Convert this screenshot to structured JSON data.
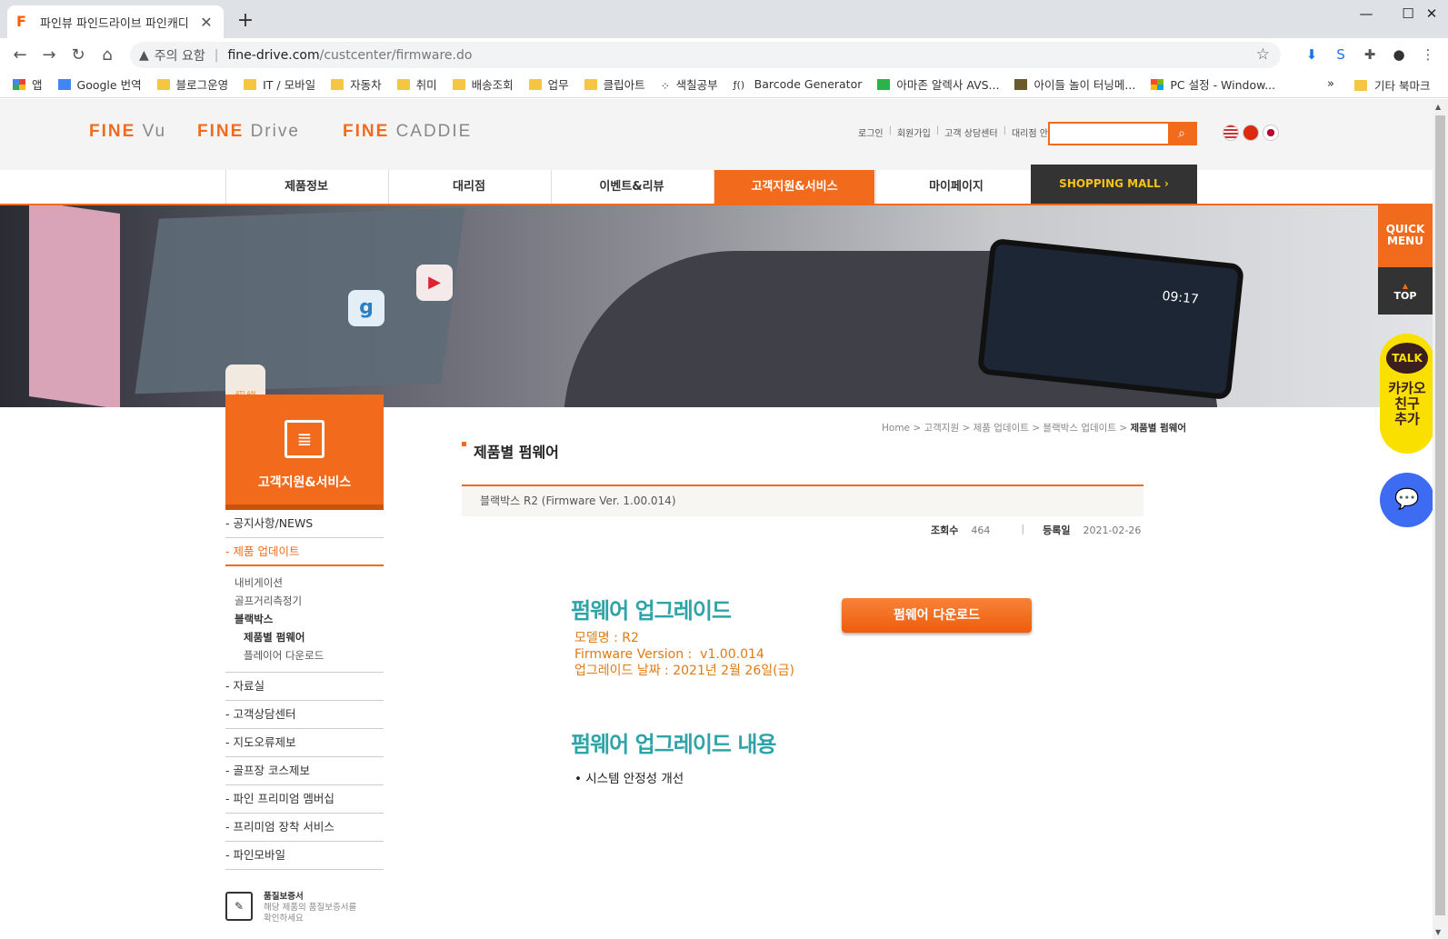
{
  "browser": {
    "tab_title": "파인뷰 파인드라이브 파인캐디",
    "address": {
      "warning": "주의 요함",
      "host": "fine-drive.com",
      "path": "/custcenter/firmware.do"
    },
    "bookmarks": [
      "앱",
      "Google 번역",
      "블로그운영",
      "IT / 모바일",
      "자동차",
      "취미",
      "배송조회",
      "업무",
      "클립아트",
      "색칠공부",
      "Barcode Generator",
      "아마존 알렉사 AVS...",
      "아이들 놀이 터닝메...",
      "PC 설정 - Window..."
    ],
    "bookmarks_more": "»",
    "other_bookmarks": "기타 북마크"
  },
  "site": {
    "logos": {
      "finevu_a": "FINE",
      "finevu_b": "Vu",
      "finedrive_a": "FINE",
      "finedrive_b": "Drive",
      "finecaddie_a": "FINE",
      "finecaddie_b": "CADDIE"
    },
    "util": [
      "로그인",
      "회원가입",
      "고객 상담센터",
      "대리점 안내"
    ],
    "gnb": [
      "제품정보",
      "대리점",
      "이벤트&리뷰",
      "고객지원&서비스",
      "마이페이지"
    ],
    "mall": "SHOPPING MALL  ›",
    "quick": {
      "line1": "QUICK",
      "line2": "MENU"
    },
    "top": "TOP",
    "talk": {
      "badge": "TALK",
      "line1": "카카오",
      "line2": "친구",
      "line3": "추가"
    },
    "banner": {
      "phone_time": "09:17",
      "atlan": "ATLAN"
    }
  },
  "lnb": {
    "title": "고객지원&서비스",
    "items_top": [
      "- 공지사항/NEWS",
      "- 제품 업데이트"
    ],
    "sub": [
      "내비게이션",
      "골프거리측정기",
      "블랙박스"
    ],
    "sub2": [
      "제품별 펌웨어",
      "플레이어 다운로드"
    ],
    "items_bottom": [
      "- 자료실",
      "- 고객상담센터",
      "- 지도오류제보",
      "- 골프장 코스제보",
      "- 파인 프리미엄 멤버십",
      "- 프리미엄 장착 서비스",
      "- 파인모바일"
    ],
    "quality": {
      "title": "품질보증서",
      "line1": "해당 제품의 품질보증서를",
      "line2": "확인하세요"
    }
  },
  "content": {
    "breadcrumb": {
      "path": "Home > 고객지원 > 제품 업데이트 > 블랙박스 업데이트 > ",
      "current": "제품별 펌웨어"
    },
    "title": "제품별 펌웨어",
    "post_title": "블랙박스 R2 (Firmware Ver. 1.00.014)",
    "views_label": "조회수",
    "views": "464",
    "date_label": "등록일",
    "date": "2021-02-26",
    "fw_heading": "펌웨어 업그레이드",
    "model": "모델명 : R2",
    "version": "Firmware Version :  v1.00.014",
    "upgrade_date": "업그레이드 날짜 : 2021년 2월 26일(금)",
    "download_button": "펌웨어 다운로드",
    "changes_heading": "펌웨어 업그레이드 내용",
    "changes": [
      "• 시스템 안정성 개선"
    ]
  },
  "colors": {
    "brand": "#f26b1d",
    "teal": "#2ea4a8",
    "info": "#e07a14"
  }
}
